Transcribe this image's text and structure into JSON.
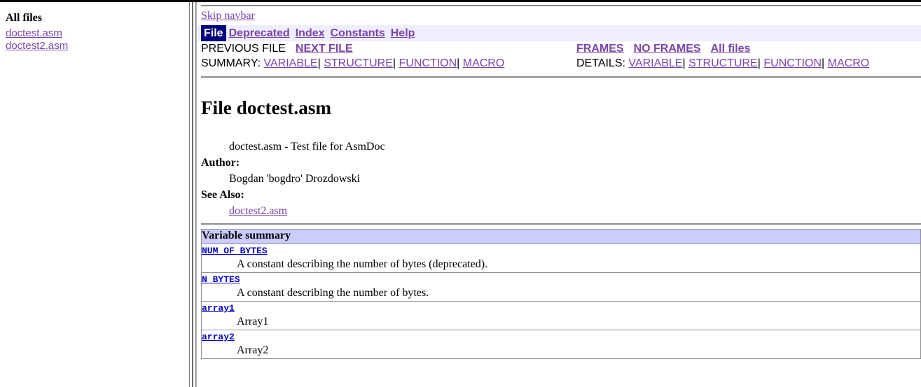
{
  "colors": {
    "link": "#7a44a8",
    "var_link": "#0000cc",
    "nav_current_bg": "#000080",
    "nav_strip_bg": "#eeeeff",
    "summary_head_bg": "#ccccff",
    "border": "#909090"
  },
  "sidebar": {
    "title": "All files",
    "items": [
      {
        "label": "doctest.asm"
      },
      {
        "label": "doctest2.asm"
      }
    ]
  },
  "content": {
    "skip_navbar": "Skip navbar",
    "navbar": {
      "items": [
        {
          "label": "File",
          "current": true
        },
        {
          "label": "Deprecated",
          "current": false
        },
        {
          "label": "Index",
          "current": false
        },
        {
          "label": "Constants",
          "current": false
        },
        {
          "label": "Help",
          "current": false
        }
      ]
    },
    "nav_left": {
      "prev_file": "PREVIOUS FILE",
      "next_file": "NEXT FILE",
      "summary_label": "SUMMARY:",
      "summary_links": [
        "VARIABLE",
        "STRUCTURE",
        "FUNCTION",
        "MACRO"
      ],
      "separator": "|"
    },
    "nav_right": {
      "frames": "FRAMES",
      "no_frames": "NO FRAMES",
      "all_files": "All files",
      "details_label": "DETAILS:",
      "details_links": [
        "VARIABLE",
        "STRUCTURE",
        "FUNCTION",
        "MACRO"
      ],
      "separator": "|"
    },
    "title": "File doctest.asm",
    "description": "doctest.asm - Test file for AsmDoc",
    "author_label": "Author:",
    "author_value": "Bogdan 'bogdro' Drozdowski",
    "see_also_label": "See Also:",
    "see_also_link": "doctest2.asm",
    "variable_summary": {
      "heading": "Variable summary",
      "rows": [
        {
          "name": "NUM_OF_BYTES",
          "description": "A constant describing the number of bytes (deprecated)."
        },
        {
          "name": "N_BYTES",
          "description": "A constant describing the number of bytes."
        },
        {
          "name": "array1",
          "description": "Array1"
        },
        {
          "name": "array2",
          "description": "Array2"
        }
      ]
    }
  }
}
